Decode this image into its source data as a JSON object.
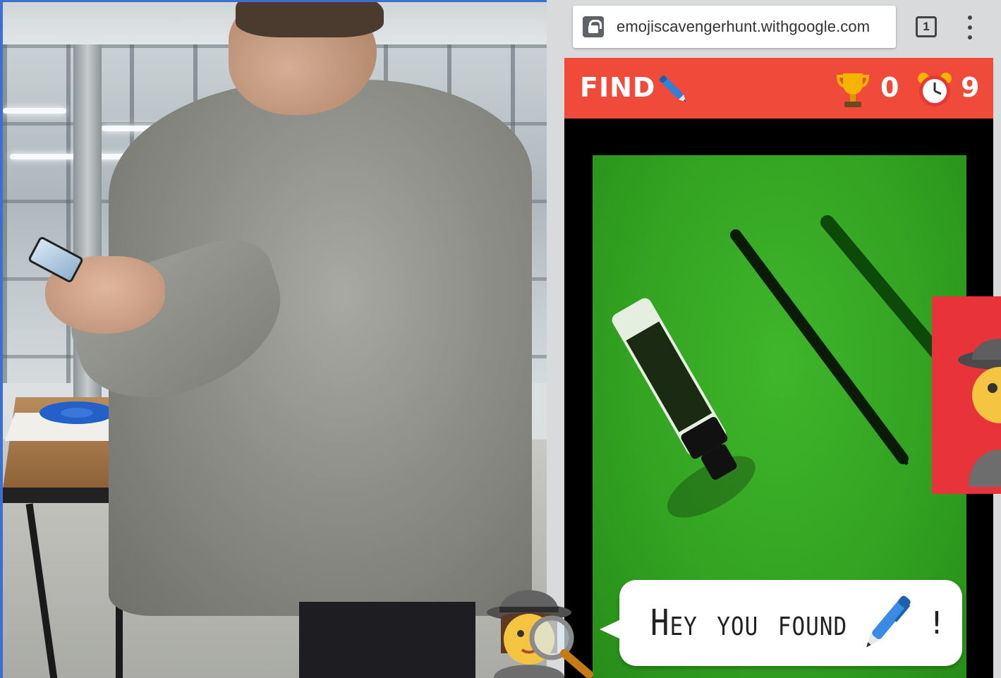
{
  "browser": {
    "url": "emojiscavengerhunt.withgoogle.com",
    "tab_count": "1"
  },
  "game": {
    "find_label": "FIND",
    "target_icon": "pen-icon",
    "score": "0",
    "timer": "9"
  },
  "bubble": {
    "text": "Hey you found",
    "punctuation": "!"
  },
  "colors": {
    "header": "#f04b3a",
    "camera_green": "#33a322",
    "card_red": "#e8333a"
  }
}
